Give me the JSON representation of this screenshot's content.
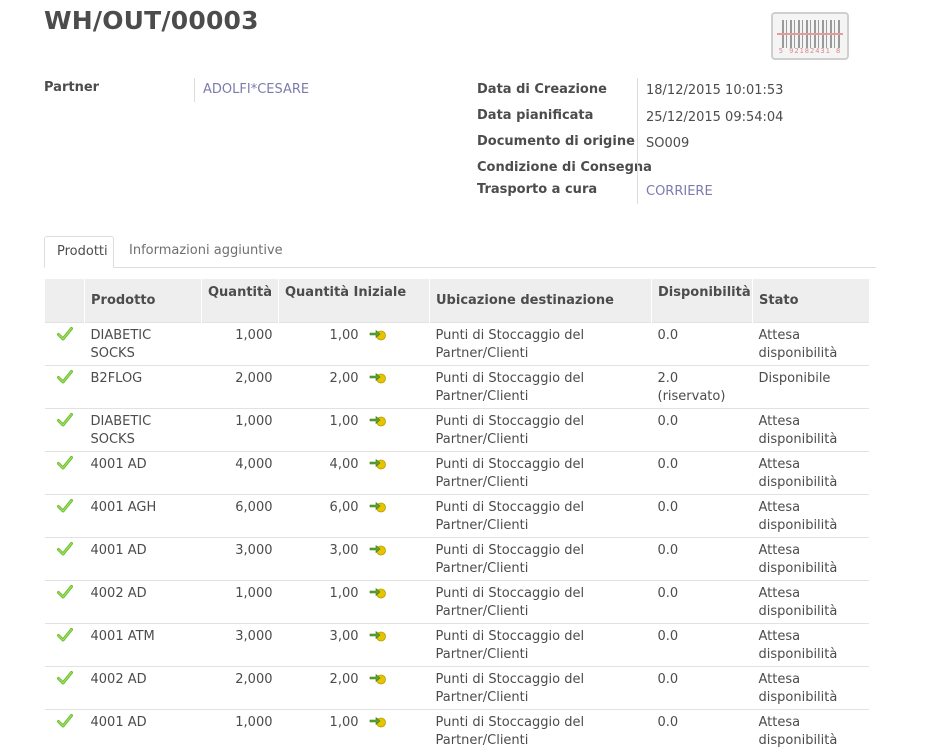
{
  "page_title": "WH/OUT/00003",
  "barcode_text": "5 92182431 8",
  "fields": {
    "partner_label": "Partner",
    "partner_value": "ADOLFI*CESARE",
    "creation_label": "Data di Creazione",
    "creation_value": "18/12/2015 10:01:53",
    "planned_label": "Data pianificata",
    "planned_value": "25/12/2015 09:54:04",
    "origin_label": "Documento di origine",
    "origin_value": "SO009",
    "delivery_label": "Condizione di Consegna",
    "delivery_value": "",
    "carrier_label": "Trasporto a cura",
    "carrier_value": "CORRIERE"
  },
  "tabs": [
    {
      "label": "Prodotti"
    },
    {
      "label": "Informazioni aggiuntive"
    }
  ],
  "table": {
    "headers": {
      "product": "Prodotto",
      "qty": "Quantità",
      "qty_init": "Quantità Iniziale",
      "location": "Ubicazione destinazione",
      "availability": "Disponibilità",
      "state": "Stato"
    },
    "rows": [
      {
        "product": "DIABETIC SOCKS",
        "qty": "1,000",
        "qty_init": "1,00",
        "location": "Punti di Stoccaggio del Partner/Clienti",
        "availability": "0.0",
        "state": "Attesa disponibilità"
      },
      {
        "product": "B2FLOG",
        "qty": "2,000",
        "qty_init": "2,00",
        "location": "Punti di Stoccaggio del Partner/Clienti",
        "availability": "2.0 (riservato)",
        "state": "Disponibile"
      },
      {
        "product": "DIABETIC SOCKS",
        "qty": "1,000",
        "qty_init": "1,00",
        "location": "Punti di Stoccaggio del Partner/Clienti",
        "availability": "0.0",
        "state": "Attesa disponibilità"
      },
      {
        "product": "4001 AD",
        "qty": "4,000",
        "qty_init": "4,00",
        "location": "Punti di Stoccaggio del Partner/Clienti",
        "availability": "0.0",
        "state": "Attesa disponibilità"
      },
      {
        "product": "4001 AGH",
        "qty": "6,000",
        "qty_init": "6,00",
        "location": "Punti di Stoccaggio del Partner/Clienti",
        "availability": "0.0",
        "state": "Attesa disponibilità"
      },
      {
        "product": "4001 AD",
        "qty": "3,000",
        "qty_init": "3,00",
        "location": "Punti di Stoccaggio del Partner/Clienti",
        "availability": "0.0",
        "state": "Attesa disponibilità"
      },
      {
        "product": "4002 AD",
        "qty": "1,000",
        "qty_init": "1,00",
        "location": "Punti di Stoccaggio del Partner/Clienti",
        "availability": "0.0",
        "state": "Attesa disponibilità"
      },
      {
        "product": "4001 ATM",
        "qty": "3,000",
        "qty_init": "3,00",
        "location": "Punti di Stoccaggio del Partner/Clienti",
        "availability": "0.0",
        "state": "Attesa disponibilità"
      },
      {
        "product": "4002 AD",
        "qty": "2,000",
        "qty_init": "2,00",
        "location": "Punti di Stoccaggio del Partner/Clienti",
        "availability": "0.0",
        "state": "Attesa disponibilità"
      },
      {
        "product": "4001 AD",
        "qty": "1,000",
        "qty_init": "1,00",
        "location": "Punti di Stoccaggio del Partner/Clienti",
        "availability": "0.0",
        "state": "Attesa disponibilità"
      }
    ]
  },
  "icons": {
    "check": "check-icon",
    "move": "move-detail-icon",
    "barcode": "barcode-icon"
  },
  "colors": {
    "link": "#7c7bad",
    "check_green": "#6bbf2e",
    "header_bg": "#eeeeee"
  }
}
